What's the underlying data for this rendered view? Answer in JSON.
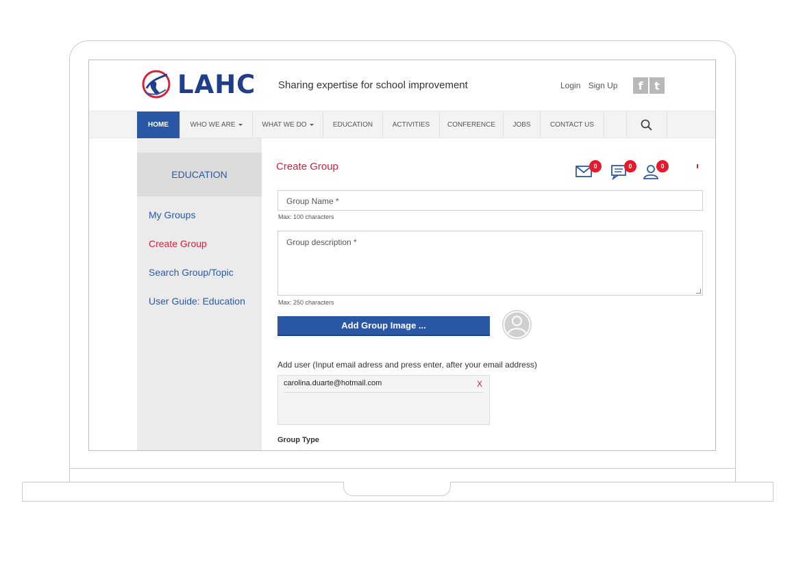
{
  "header": {
    "logo_text": "LAHC",
    "tagline": "Sharing expertise for school improvement",
    "login": "Login",
    "signup": "Sign Up",
    "social": [
      {
        "icon": "facebook-icon",
        "glyph": "f"
      },
      {
        "icon": "twitter-icon",
        "glyph": "t"
      }
    ]
  },
  "nav": {
    "items": [
      {
        "label": "HOME",
        "active": true,
        "dropdown": false
      },
      {
        "label": "WHO WE ARE",
        "active": false,
        "dropdown": true
      },
      {
        "label": "WHAT WE DO",
        "active": false,
        "dropdown": true
      },
      {
        "label": "EDUCATION",
        "active": false,
        "dropdown": false
      },
      {
        "label": "ACTIVITIES",
        "active": false,
        "dropdown": false
      },
      {
        "label": "CONFERENCE",
        "active": false,
        "dropdown": false
      },
      {
        "label": "JOBS",
        "active": false,
        "dropdown": false
      },
      {
        "label": "CONTACT US",
        "active": false,
        "dropdown": false
      }
    ],
    "search_icon": "search-icon"
  },
  "sidebar": {
    "heading": "EDUCATION",
    "items": [
      {
        "label": "My Groups",
        "active": false
      },
      {
        "label": "Create Group",
        "active": true
      },
      {
        "label": "Search Group/Topic",
        "active": false
      },
      {
        "label": "User Guide: Education",
        "active": false
      }
    ]
  },
  "main": {
    "title": "Create Group",
    "notifications": [
      {
        "icon": "mail-icon",
        "count": "0"
      },
      {
        "icon": "messages-icon",
        "count": "0"
      },
      {
        "icon": "user-requests-icon",
        "count": "0"
      }
    ],
    "group_name_placeholder": "Group Name *",
    "group_name_hint": "Max: 100 characters",
    "group_desc_placeholder": "Group description *",
    "group_desc_hint": "Max: 250 characters",
    "add_image_label": "Add Group Image ...",
    "add_user_label": "Add user (Input email adress and press enter, after your email address)",
    "emails": [
      {
        "value": "carolina.duarte@hotmail.com",
        "remove": "X"
      }
    ],
    "group_type_label": "Group Type"
  },
  "colors": {
    "brand_blue": "#2a58a4",
    "accent_red": "#d81e3a",
    "badge_red": "#e31b2d"
  }
}
